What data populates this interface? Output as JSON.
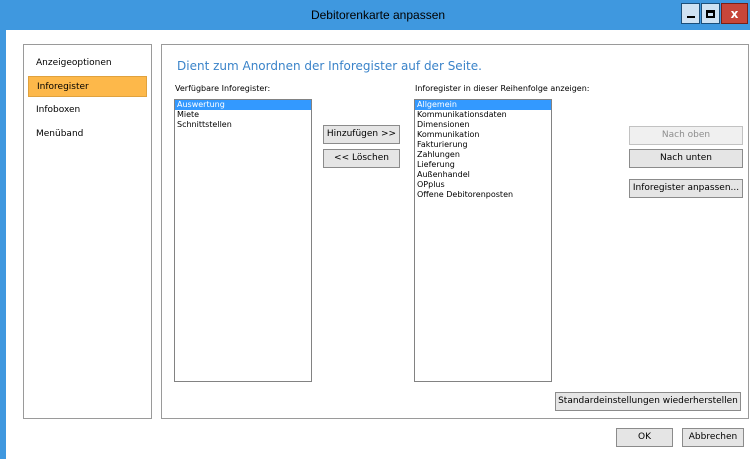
{
  "window": {
    "title": "Debitorenkarte anpassen",
    "minimize_glyph": "",
    "close_glyph": "x",
    "accent_color": "#3f98df"
  },
  "nav": {
    "items": [
      {
        "label": "Anzeigeoptionen",
        "active": false
      },
      {
        "label": "Inforegister",
        "active": true
      },
      {
        "label": "Infoboxen",
        "active": false
      },
      {
        "label": "Menüband",
        "active": false
      }
    ]
  },
  "panel": {
    "heading": "Dient zum Anordnen der Inforegister auf der Seite.",
    "available_label": "Verfügbare Inforegister:",
    "available_items": [
      {
        "label": "Auswertung",
        "selected": true
      },
      {
        "label": "Miete",
        "selected": false
      },
      {
        "label": "Schnittstellen",
        "selected": false
      }
    ],
    "shown_label": "Inforegister in dieser Reihenfolge anzeigen:",
    "shown_items": [
      {
        "label": "Allgemein",
        "selected": true
      },
      {
        "label": "Kommunikationsdaten",
        "selected": false
      },
      {
        "label": "Dimensionen",
        "selected": false
      },
      {
        "label": "Kommunikation",
        "selected": false
      },
      {
        "label": "Fakturierung",
        "selected": false
      },
      {
        "label": "Zahlungen",
        "selected": false
      },
      {
        "label": "Lieferung",
        "selected": false
      },
      {
        "label": "Außenhandel",
        "selected": false
      },
      {
        "label": "OPplus",
        "selected": false
      },
      {
        "label": "Offene Debitorenposten",
        "selected": false
      }
    ],
    "add_button": "Hinzufügen >>",
    "remove_button": "<< Löschen",
    "move_up_button": "Nach oben",
    "move_down_button": "Nach unten",
    "customize_button": "Inforegister anpassen...",
    "restore_button": "Standardeinstellungen wiederherstellen"
  },
  "footer": {
    "ok_button": "OK",
    "cancel_button": "Abbrechen"
  }
}
